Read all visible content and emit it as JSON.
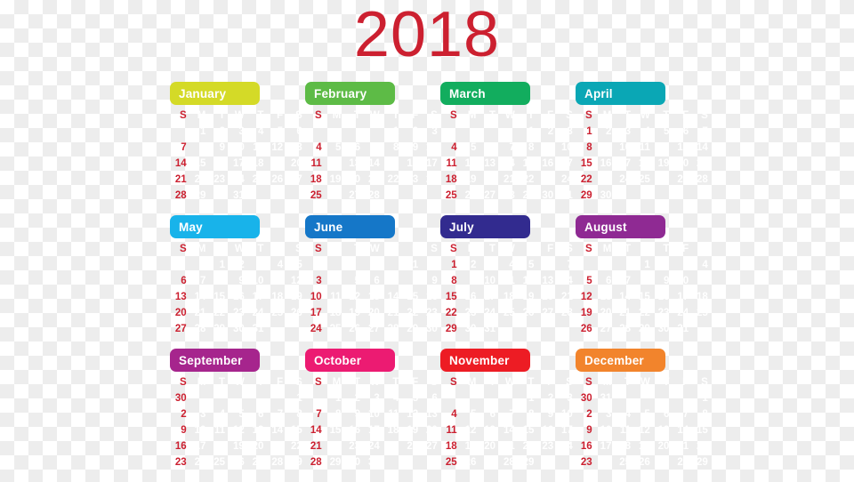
{
  "year_title": "2018",
  "year_color": "#cc2030",
  "sunday_color": "#cc2030",
  "weekday_color": "#ffffff",
  "weekday_headers": [
    "S",
    "M",
    "T",
    "W",
    "T",
    "F",
    "S"
  ],
  "months": [
    {
      "name": "January",
      "color": "#d4da27",
      "weeks": [
        [
          "",
          "1",
          "2",
          "3",
          "4",
          "5",
          "6"
        ],
        [
          "7",
          "8",
          "9",
          "10",
          "11",
          "12",
          "13"
        ],
        [
          "14",
          "15",
          "16",
          "17",
          "18",
          "19",
          "20"
        ],
        [
          "21",
          "22",
          "23",
          "24",
          "25",
          "26",
          "27"
        ],
        [
          "28",
          "29",
          "30",
          "31",
          "",
          "",
          ""
        ]
      ]
    },
    {
      "name": "February",
      "color": "#5dbb46",
      "weeks": [
        [
          "",
          "",
          "",
          "",
          "1",
          "2",
          "3"
        ],
        [
          "4",
          "5",
          "6",
          "7",
          "8",
          "9",
          "10"
        ],
        [
          "11",
          "12",
          "13",
          "14",
          "15",
          "16",
          "17"
        ],
        [
          "18",
          "19",
          "20",
          "21",
          "22",
          "23",
          "24"
        ],
        [
          "25",
          "26",
          "27",
          "28",
          "",
          "",
          ""
        ]
      ]
    },
    {
      "name": "March",
      "color": "#12ad5e",
      "weeks": [
        [
          "",
          "",
          "",
          "",
          "1",
          "2",
          "3"
        ],
        [
          "4",
          "5",
          "6",
          "7",
          "8",
          "9",
          "10"
        ],
        [
          "11",
          "12",
          "13",
          "14",
          "15",
          "16",
          "17"
        ],
        [
          "18",
          "19",
          "20",
          "21",
          "22",
          "23",
          "24"
        ],
        [
          "25",
          "26",
          "27",
          "28",
          "29",
          "30",
          "31"
        ]
      ]
    },
    {
      "name": "April",
      "color": "#0aa7b5",
      "weeks": [
        [
          "1",
          "2",
          "3",
          "4",
          "5",
          "6",
          "7"
        ],
        [
          "8",
          "9",
          "10",
          "11",
          "12",
          "13",
          "14"
        ],
        [
          "15",
          "16",
          "17",
          "18",
          "19",
          "20",
          "21"
        ],
        [
          "22",
          "23",
          "24",
          "25",
          "26",
          "27",
          "28"
        ],
        [
          "29",
          "30",
          "",
          "",
          "",
          "",
          ""
        ]
      ]
    },
    {
      "name": "May",
      "color": "#18b3ea",
      "weeks": [
        [
          "",
          "",
          "1",
          "2",
          "3",
          "4",
          "5"
        ],
        [
          "6",
          "7",
          "8",
          "9",
          "10",
          "11",
          "12"
        ],
        [
          "13",
          "14",
          "15",
          "16",
          "17",
          "18",
          "19"
        ],
        [
          "20",
          "21",
          "22",
          "23",
          "24",
          "25",
          "26"
        ],
        [
          "27",
          "28",
          "29",
          "30",
          "31",
          "",
          ""
        ]
      ]
    },
    {
      "name": "June",
      "color": "#1577c8",
      "weeks": [
        [
          "",
          "",
          "",
          "",
          "",
          "1",
          "2"
        ],
        [
          "3",
          "4",
          "5",
          "6",
          "7",
          "8",
          "9"
        ],
        [
          "10",
          "11",
          "12",
          "13",
          "14",
          "15",
          "16"
        ],
        [
          "17",
          "18",
          "19",
          "20",
          "21",
          "22",
          "23"
        ],
        [
          "24",
          "25",
          "26",
          "27",
          "28",
          "29",
          "30"
        ]
      ]
    },
    {
      "name": "July",
      "color": "#322b8f",
      "weeks": [
        [
          "1",
          "2",
          "3",
          "4",
          "5",
          "6",
          "7"
        ],
        [
          "8",
          "9",
          "10",
          "11",
          "12",
          "13",
          "14"
        ],
        [
          "15",
          "16",
          "17",
          "18",
          "19",
          "20",
          "21"
        ],
        [
          "22",
          "23",
          "24",
          "25",
          "26",
          "27",
          "28"
        ],
        [
          "29",
          "30",
          "31",
          "",
          "",
          "",
          ""
        ]
      ]
    },
    {
      "name": "August",
      "color": "#8f2a93",
      "weeks": [
        [
          "",
          "",
          "",
          "1",
          "2",
          "3",
          "4"
        ],
        [
          "5",
          "6",
          "7",
          "8",
          "9",
          "10",
          "11"
        ],
        [
          "12",
          "13",
          "14",
          "15",
          "16",
          "17",
          "18"
        ],
        [
          "19",
          "20",
          "21",
          "22",
          "23",
          "24",
          "25"
        ],
        [
          "26",
          "27",
          "28",
          "29",
          "30",
          "31",
          ""
        ]
      ]
    },
    {
      "name": "September",
      "color": "#a6258d",
      "weeks": [
        [
          "30",
          "",
          "",
          "",
          "",
          "",
          "1"
        ],
        [
          "2",
          "3",
          "4",
          "5",
          "6",
          "7",
          "8"
        ],
        [
          "9",
          "10",
          "11",
          "12",
          "13",
          "14",
          "15"
        ],
        [
          "16",
          "17",
          "18",
          "19",
          "20",
          "21",
          "22"
        ],
        [
          "23",
          "24",
          "25",
          "26",
          "27",
          "28",
          "29"
        ]
      ]
    },
    {
      "name": "October",
      "color": "#ec1b72",
      "weeks": [
        [
          "",
          "1",
          "2",
          "3",
          "4",
          "5",
          "6"
        ],
        [
          "7",
          "8",
          "9",
          "10",
          "11",
          "12",
          "13"
        ],
        [
          "14",
          "15",
          "16",
          "17",
          "18",
          "19",
          "20"
        ],
        [
          "21",
          "22",
          "23",
          "24",
          "25",
          "26",
          "27"
        ],
        [
          "28",
          "29",
          "30",
          "31",
          "",
          "",
          ""
        ]
      ]
    },
    {
      "name": "November",
      "color": "#ed1c24",
      "weeks": [
        [
          "",
          "",
          "",
          "",
          "1",
          "2",
          "3"
        ],
        [
          "4",
          "5",
          "6",
          "7",
          "8",
          "9",
          "10"
        ],
        [
          "11",
          "12",
          "13",
          "14",
          "15",
          "16",
          "17"
        ],
        [
          "18",
          "19",
          "20",
          "21",
          "22",
          "23",
          "24"
        ],
        [
          "25",
          "26",
          "27",
          "28",
          "29",
          "30",
          ""
        ]
      ]
    },
    {
      "name": "December",
      "color": "#f2842c",
      "weeks": [
        [
          "30",
          "31",
          "",
          "",
          "",
          "",
          "1"
        ],
        [
          "2",
          "3",
          "4",
          "5",
          "6",
          "7",
          "8"
        ],
        [
          "9",
          "10",
          "11",
          "12",
          "13",
          "14",
          "15"
        ],
        [
          "16",
          "17",
          "18",
          "19",
          "20",
          "21",
          "22"
        ],
        [
          "23",
          "24",
          "25",
          "26",
          "27",
          "28",
          "29"
        ]
      ]
    }
  ]
}
